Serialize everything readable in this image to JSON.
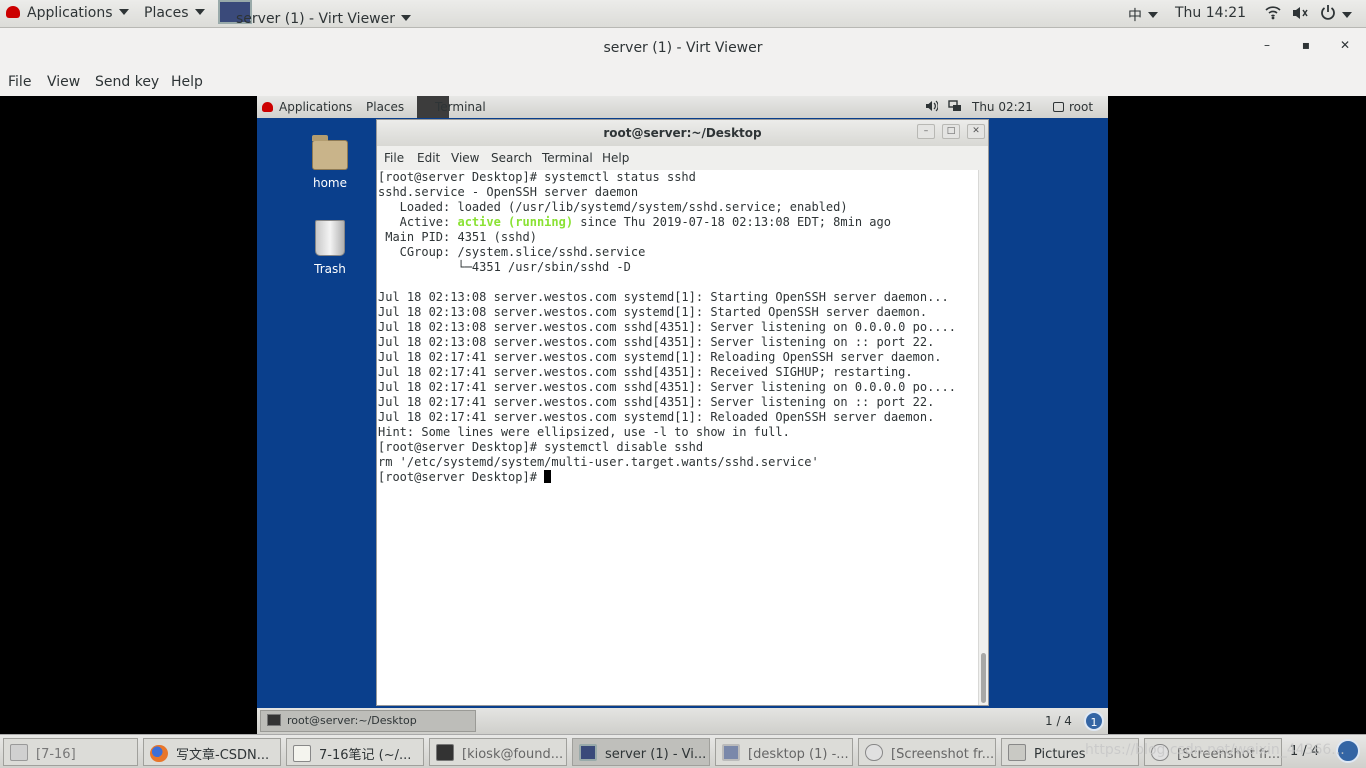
{
  "top_bar": {
    "applications": "Applications",
    "places": "Places",
    "window_title": "server (1) - Virt Viewer",
    "input_method": "中",
    "clock": "Thu 14:21"
  },
  "viewer": {
    "title": "server (1) - Virt Viewer",
    "menu": [
      "File",
      "View",
      "Send key",
      "Help"
    ],
    "minimize_glyph": "–",
    "maximize_glyph": "▪",
    "close_glyph": "✕"
  },
  "guest": {
    "top_bar": {
      "applications": "Applications",
      "places": "Places",
      "terminal": "Terminal",
      "clock": "Thu 02:21",
      "user": "root"
    },
    "desktop_icons": [
      {
        "label": "home",
        "icon": "folder-home-icon"
      },
      {
        "label": "Trash",
        "icon": "trash-icon"
      }
    ],
    "terminal": {
      "title": "root@server:~/Desktop",
      "menu": [
        "File",
        "Edit",
        "View",
        "Search",
        "Terminal",
        "Help"
      ],
      "lines": [
        "[root@server Desktop]# systemctl status sshd",
        "sshd.service - OpenSSH server daemon",
        "   Loaded: loaded (/usr/lib/systemd/system/sshd.service; enabled)",
        "   Active: ",
        " Main PID: 4351 (sshd)",
        "   CGroup: /system.slice/sshd.service",
        "           └─4351 /usr/sbin/sshd -D",
        "",
        "Jul 18 02:13:08 server.westos.com systemd[1]: Starting OpenSSH server daemon...",
        "Jul 18 02:13:08 server.westos.com systemd[1]: Started OpenSSH server daemon.",
        "Jul 18 02:13:08 server.westos.com sshd[4351]: Server listening on 0.0.0.0 po....",
        "Jul 18 02:13:08 server.westos.com sshd[4351]: Server listening on :: port 22.",
        "Jul 18 02:17:41 server.westos.com systemd[1]: Reloading OpenSSH server daemon.",
        "Jul 18 02:17:41 server.westos.com sshd[4351]: Received SIGHUP; restarting.",
        "Jul 18 02:17:41 server.westos.com sshd[4351]: Server listening on 0.0.0.0 po....",
        "Jul 18 02:17:41 server.westos.com sshd[4351]: Server listening on :: port 22.",
        "Jul 18 02:17:41 server.westos.com systemd[1]: Reloaded OpenSSH server daemon.",
        "Hint: Some lines were ellipsized, use -l to show in full.",
        "[root@server Desktop]# systemctl disable sshd",
        "rm '/etc/systemd/system/multi-user.target.wants/sshd.service'",
        "[root@server Desktop]# "
      ],
      "active_status": "active (running)",
      "active_rest": " since Thu 2019-07-18 02:13:08 EDT; 8min ago",
      "status_color": "#8ae234"
    },
    "taskbar": {
      "item": "root@server:~/Desktop",
      "workspace": "1 / 4",
      "badge": "1"
    }
  },
  "host_taskbar": {
    "items": [
      {
        "label": "[7-16]",
        "icon": "file-icon"
      },
      {
        "label": "写文章-CSDN...",
        "icon": "firefox-icon"
      },
      {
        "label": "7-16笔记 (~/...",
        "icon": "text-editor-icon"
      },
      {
        "label": "[kiosk@found...",
        "icon": "terminal-icon"
      },
      {
        "label": "server (1) - Vi...",
        "icon": "virt-viewer-icon"
      },
      {
        "label": "[desktop (1) -...",
        "icon": "virt-viewer-icon"
      },
      {
        "label": "[Screenshot fr...",
        "icon": "screenshot-icon"
      },
      {
        "label": "Pictures",
        "icon": "folder-icon"
      },
      {
        "label": "[Screenshot fr...",
        "icon": "screenshot-icon"
      }
    ],
    "workspace": "1 / 4",
    "watermark": "https://blog.csdn.net/weixin_44366..."
  }
}
